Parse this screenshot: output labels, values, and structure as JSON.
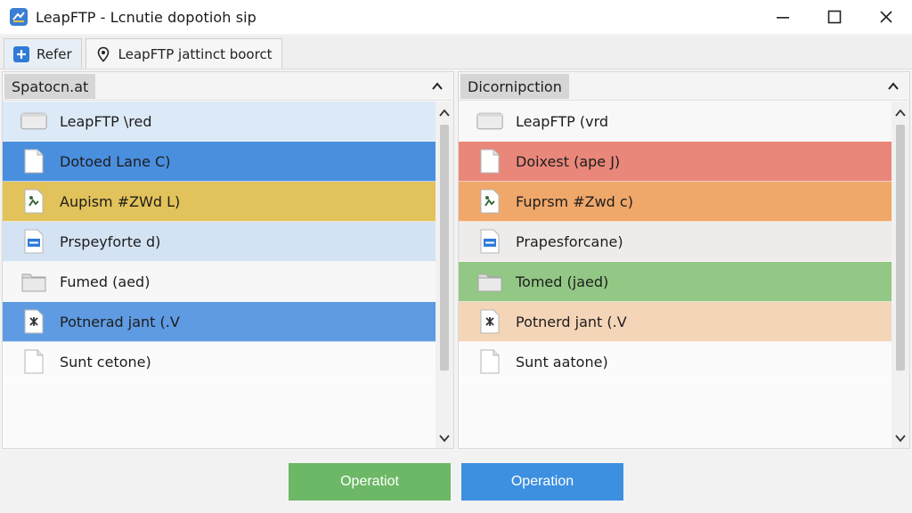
{
  "window": {
    "title": "LeapFTP - Lcnutie dopotioh sip",
    "icon": "app-icon",
    "controls": [
      "minimize-icon",
      "maximize-icon",
      "close-icon"
    ]
  },
  "tabs": [
    {
      "label": "Refer",
      "icon": "add-icon"
    },
    {
      "label": "LeapFTP jattinct boorct",
      "icon": "location-pin-icon"
    }
  ],
  "left_pane": {
    "header": "Spatocn.at",
    "rows": [
      {
        "label": "LeapFTP \\red",
        "icon": "drive-icon",
        "color": "#dce9f7"
      },
      {
        "label": "Dotoed Lane C)",
        "icon": "document-icon",
        "color": "#4a8fde"
      },
      {
        "label": "Aupism #ZWd L)",
        "icon": "image-file-icon",
        "color": "#e2c25a"
      },
      {
        "label": "Prspeyforte d)",
        "icon": "blue-file-icon",
        "color": "#d4e3f4"
      },
      {
        "label": "Fumed (aed)",
        "icon": "folder-icon",
        "color": "#f7f7f7"
      },
      {
        "label": "Potnerad jant (.V",
        "icon": "archive-icon",
        "color": "#5f9be2"
      },
      {
        "label": "Sunt cetone)",
        "icon": "document-icon",
        "color": "#fbfbfb"
      }
    ]
  },
  "right_pane": {
    "header": "Dicornipction",
    "rows": [
      {
        "label": "LeapFTP (vrd",
        "icon": "drive-icon",
        "color": "#f8f8f8"
      },
      {
        "label": "Doixest (ape J)",
        "icon": "document-icon",
        "color": "#e9877a"
      },
      {
        "label": "Fuprsm #Zwd c)",
        "icon": "image-file-icon",
        "color": "#f0a86a"
      },
      {
        "label": "Prapesforcane)",
        "icon": "blue-file-icon",
        "color": "#eeecea"
      },
      {
        "label": "Tomed (jaed)",
        "icon": "folder-icon",
        "color": "#93c785"
      },
      {
        "label": "Potnerd jant (.V",
        "icon": "archive-icon",
        "color": "#f5d5b8"
      },
      {
        "label": "Sunt aatone)",
        "icon": "document-icon",
        "color": "#fbfbfb"
      }
    ]
  },
  "buttons": {
    "primary_label": "Operatiot",
    "secondary_label": "Operation",
    "primary_color": "#6cb866",
    "secondary_color": "#3d8fe0"
  }
}
